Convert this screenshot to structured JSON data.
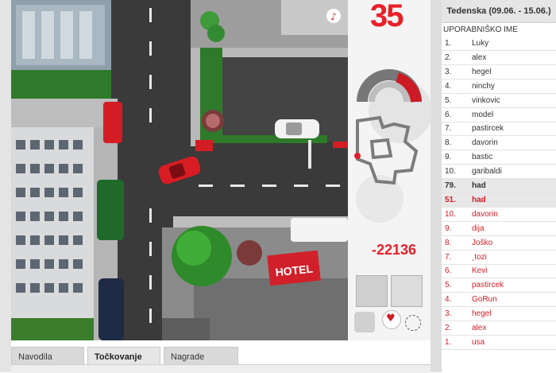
{
  "game": {
    "timer": "35",
    "score": "-22136",
    "hotel_sign": "HOTEL",
    "colors": {
      "timer": "#e8202a",
      "score": "#e8202a",
      "gauge_fill": "#cc1b24",
      "map_marker": "#e0202a"
    },
    "gauge_level": 0.35,
    "icons": [
      "music-note-icon",
      "heart-icon"
    ]
  },
  "tabs": [
    {
      "label": "Navodila"
    },
    {
      "label": "Točkovanje"
    },
    {
      "label": "Nagrade"
    }
  ],
  "leaderboard": {
    "period": "Tedenska (09.06. - 15.06.)",
    "column": "UPORABNIŠKO IME",
    "rows": [
      {
        "rank": "1.",
        "name": "Luky"
      },
      {
        "rank": "2.",
        "name": "alex"
      },
      {
        "rank": "3.",
        "name": "hegel"
      },
      {
        "rank": "4.",
        "name": "ninchy"
      },
      {
        "rank": "5.",
        "name": "vinkovic"
      },
      {
        "rank": "6.",
        "name": "model"
      },
      {
        "rank": "7.",
        "name": "pastircek"
      },
      {
        "rank": "8.",
        "name": "davorin"
      },
      {
        "rank": "9.",
        "name": "bastic"
      },
      {
        "rank": "10.",
        "name": "garibaldi"
      },
      {
        "rank": "79.",
        "name": "had"
      },
      {
        "rank": "51.",
        "name": "had"
      },
      {
        "rank": "10.",
        "name": "davorin"
      },
      {
        "rank": "9.",
        "name": "dija"
      },
      {
        "rank": "8.",
        "name": "Joško"
      },
      {
        "rank": "7.",
        "name": "¸tozi"
      },
      {
        "rank": "6.",
        "name": "Kevi"
      },
      {
        "rank": "5.",
        "name": "pastircek"
      },
      {
        "rank": "4.",
        "name": "GoRun"
      },
      {
        "rank": "3.",
        "name": "hegel"
      },
      {
        "rank": "2.",
        "name": "alex"
      },
      {
        "rank": "1.",
        "name": "usa"
      }
    ]
  }
}
